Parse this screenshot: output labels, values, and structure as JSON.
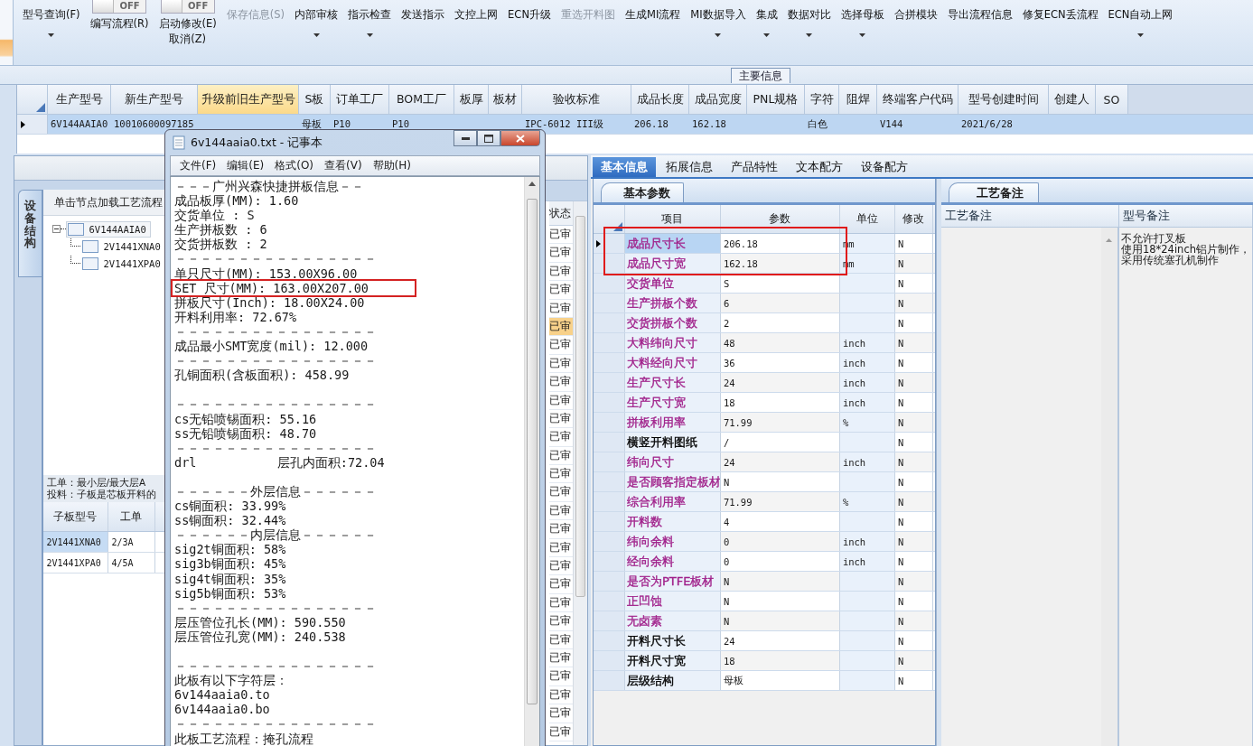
{
  "toolbar": {
    "buttons": [
      {
        "lines": [
          "型号查询(F)"
        ],
        "caret": true,
        "disabled": false
      },
      {
        "lines": [
          "编写流程(R)"
        ],
        "toggle": {
          "label": "OFF",
          "on": false
        },
        "caret": false,
        "disabled": false
      },
      {
        "lines": [
          "启动修改(E)",
          "取消(Z)"
        ],
        "toggle": {
          "label": "OFF",
          "on": false
        },
        "caret": false,
        "disabled": false
      },
      {
        "lines": [
          "保存信息(S)"
        ],
        "caret": false,
        "disabled": true
      },
      {
        "lines": [
          "内部审核"
        ],
        "caret": true,
        "disabled": false
      },
      {
        "lines": [
          "指示检查"
        ],
        "caret": true,
        "disabled": false
      },
      {
        "lines": [
          "发送指示"
        ],
        "caret": false,
        "disabled": false
      },
      {
        "lines": [
          "文控上网"
        ],
        "caret": false,
        "disabled": false
      },
      {
        "lines": [
          "ECN升级"
        ],
        "caret": false,
        "disabled": false
      },
      {
        "lines": [
          "重选开料图"
        ],
        "caret": false,
        "disabled": true
      },
      {
        "lines": [
          "生成MI流程"
        ],
        "caret": false,
        "disabled": false
      },
      {
        "lines": [
          "MI数据导入"
        ],
        "caret": true,
        "disabled": false
      },
      {
        "lines": [
          "集成"
        ],
        "caret": true,
        "disabled": false
      },
      {
        "lines": [
          "数据对比"
        ],
        "caret": true,
        "disabled": false
      },
      {
        "lines": [
          "选择母板"
        ],
        "caret": true,
        "disabled": false
      },
      {
        "lines": [
          "合拼模块"
        ],
        "caret": false,
        "disabled": false
      },
      {
        "lines": [
          "导出流程信息"
        ],
        "caret": false,
        "disabled": false
      },
      {
        "lines": [
          "修复ECN丢流程"
        ],
        "caret": false,
        "disabled": false
      },
      {
        "lines": [
          "ECN自动上网"
        ],
        "caret": true,
        "disabled": false
      }
    ]
  },
  "group_label": "主要信息",
  "main_grid": {
    "columns": [
      {
        "label": "生产型号",
        "highlighted": false
      },
      {
        "label": "新生产型号",
        "highlighted": false
      },
      {
        "label": "升级前旧生产型号",
        "highlighted": true
      },
      {
        "label": "S板",
        "highlighted": false
      },
      {
        "label": "订单工厂",
        "highlighted": false
      },
      {
        "label": "BOM工厂",
        "highlighted": false
      },
      {
        "label": "板厚",
        "highlighted": false
      },
      {
        "label": "板材",
        "highlighted": false
      },
      {
        "label": "验收标准",
        "highlighted": false
      },
      {
        "label": "成品长度",
        "highlighted": false
      },
      {
        "label": "成品宽度",
        "highlighted": false
      },
      {
        "label": "PNL规格",
        "highlighted": false
      },
      {
        "label": "字符",
        "highlighted": false
      },
      {
        "label": "阻焊",
        "highlighted": false
      },
      {
        "label": "终端客户代码",
        "highlighted": false
      },
      {
        "label": "型号创建时间",
        "highlighted": false
      },
      {
        "label": "创建人",
        "highlighted": false
      },
      {
        "label": "SO",
        "highlighted": false
      }
    ],
    "rows": [
      {
        "selected": true,
        "cells": [
          "6V144AAIA0",
          "10010600097185",
          "",
          "母板",
          "P10",
          "P10",
          "",
          "",
          "IPC-6012 III级",
          "206.18",
          "162.18",
          "",
          "白色",
          "",
          "V144",
          "2021/6/28",
          "",
          ""
        ]
      }
    ]
  },
  "left_panel": {
    "vertical_tab": "设备结构",
    "tree_header": "单击节点加载工艺流程",
    "tree": [
      {
        "label": "6V144AAIA0",
        "expanded": true,
        "selected": true,
        "children": [
          {
            "label": "2V1441XNA0",
            "selected": false
          },
          {
            "label": "2V1441XPA0",
            "selected": false
          }
        ]
      }
    ],
    "info_lines": [
      "工单：最小层/最大层A",
      "投料：子板是芯板开料的"
    ],
    "subboards": {
      "columns": [
        "子板型号",
        "工单"
      ],
      "rows": [
        {
          "cells": [
            "2V1441XNA0",
            "2/3A"
          ],
          "selected": true
        },
        {
          "cells": [
            "2V1441XPA0",
            "4/5A"
          ],
          "selected": false
        }
      ]
    },
    "status_column": {
      "header": "状态",
      "cells": [
        {
          "text": "已审",
          "selected": false
        },
        {
          "text": "已审",
          "selected": false
        },
        {
          "text": "已审",
          "selected": false
        },
        {
          "text": "已审",
          "selected": false
        },
        {
          "text": "已审",
          "selected": false
        },
        {
          "text": "已审",
          "selected": true
        },
        {
          "text": "已审",
          "selected": false
        },
        {
          "text": "已审",
          "selected": false
        },
        {
          "text": "已审",
          "selected": false
        },
        {
          "text": "已审",
          "selected": false
        },
        {
          "text": "已审",
          "selected": false
        },
        {
          "text": "已审",
          "selected": false
        },
        {
          "text": "已审",
          "selected": false
        },
        {
          "text": "已审",
          "selected": false
        },
        {
          "text": "已审",
          "selected": false
        },
        {
          "text": "已审",
          "selected": false
        },
        {
          "text": "已审",
          "selected": false
        },
        {
          "text": "已审",
          "selected": false
        },
        {
          "text": "已审",
          "selected": false
        },
        {
          "text": "已审",
          "selected": false
        },
        {
          "text": "已审",
          "selected": false
        },
        {
          "text": "已审",
          "selected": false
        },
        {
          "text": "已审",
          "selected": false
        },
        {
          "text": "已审",
          "selected": false
        },
        {
          "text": "已审",
          "selected": false
        },
        {
          "text": "已审",
          "selected": false
        },
        {
          "text": "已审",
          "selected": false
        },
        {
          "text": "已审",
          "selected": false
        }
      ]
    }
  },
  "right_panel": {
    "tabs": [
      {
        "label": "基本信息",
        "selected": true
      },
      {
        "label": "拓展信息",
        "selected": false
      },
      {
        "label": "产品特性",
        "selected": false
      },
      {
        "label": "文本配方",
        "selected": false
      },
      {
        "label": "设备配方",
        "selected": false
      }
    ],
    "params_tab": "基本参数",
    "params_columns": [
      "项目",
      "参数",
      "单位",
      "修改"
    ],
    "params": [
      {
        "name": "成品尺寸长",
        "value": "206.18",
        "unit": "mm",
        "modified": "N",
        "color": "#a0208a",
        "selected": true,
        "highlighted": true
      },
      {
        "name": "成品尺寸宽",
        "value": "162.18",
        "unit": "mm",
        "modified": "N",
        "color": "#a0208a",
        "selected": false,
        "highlighted": true
      },
      {
        "name": "交货单位",
        "value": "S",
        "modified": "N",
        "color": "#a0208a",
        "selected": false,
        "highlighted": false
      },
      {
        "name": "生产拼板个数",
        "value": "6",
        "modified": "N",
        "color": "#a0208a",
        "selected": false,
        "highlighted": false
      },
      {
        "name": "交货拼板个数",
        "value": "2",
        "modified": "N",
        "color": "#a0208a",
        "selected": false,
        "highlighted": false
      },
      {
        "name": "大料纬向尺寸",
        "value": "48",
        "unit": "inch",
        "modified": "N",
        "color": "#a0208a",
        "selected": false,
        "highlighted": false
      },
      {
        "name": "大料经向尺寸",
        "value": "36",
        "unit": "inch",
        "modified": "N",
        "color": "#a0208a",
        "selected": false,
        "highlighted": false
      },
      {
        "name": "生产尺寸长",
        "value": "24",
        "unit": "inch",
        "modified": "N",
        "color": "#a0208a",
        "selected": false,
        "highlighted": false
      },
      {
        "name": "生产尺寸宽",
        "value": "18",
        "unit": "inch",
        "modified": "N",
        "color": "#a0208a",
        "selected": false,
        "highlighted": false
      },
      {
        "name": "拼板利用率",
        "value": "71.99",
        "unit": "%",
        "modified": "N",
        "color": "#a0208a",
        "selected": false,
        "highlighted": false
      },
      {
        "name": "横竖开料图纸",
        "value": "/",
        "modified": "N",
        "color": "#000000",
        "selected": false,
        "highlighted": false
      },
      {
        "name": "纬向尺寸",
        "value": "24",
        "unit": "inch",
        "modified": "N",
        "color": "#a0208a",
        "selected": false,
        "highlighted": false
      },
      {
        "name": "是否顾客指定板材",
        "value": "N",
        "modified": "N",
        "color": "#a0208a",
        "selected": false,
        "highlighted": false
      },
      {
        "name": "综合利用率",
        "value": "71.99",
        "unit": "%",
        "modified": "N",
        "color": "#a0208a",
        "selected": false,
        "highlighted": false
      },
      {
        "name": "开料数",
        "value": "4",
        "modified": "N",
        "color": "#a0208a",
        "selected": false,
        "highlighted": false
      },
      {
        "name": "纬向余料",
        "value": "0",
        "unit": "inch",
        "modified": "N",
        "color": "#a0208a",
        "selected": false,
        "highlighted": false
      },
      {
        "name": "经向余料",
        "value": "0",
        "unit": "inch",
        "modified": "N",
        "color": "#a0208a",
        "selected": false,
        "highlighted": false
      },
      {
        "name": "是否为PTFE板材",
        "value": "N",
        "modified": "N",
        "color": "#a0208a",
        "selected": false,
        "highlighted": false
      },
      {
        "name": "正凹蚀",
        "value": "N",
        "modified": "N",
        "color": "#a0208a",
        "selected": false,
        "highlighted": false
      },
      {
        "name": "无卤素",
        "value": "N",
        "modified": "N",
        "color": "#a0208a",
        "selected": false,
        "highlighted": false
      },
      {
        "name": "开料尺寸长",
        "value": "24",
        "modified": "N",
        "color": "#000000",
        "selected": false,
        "highlighted": false
      },
      {
        "name": "开料尺寸宽",
        "value": "18",
        "modified": "N",
        "color": "#000000",
        "selected": false,
        "highlighted": false
      },
      {
        "name": "层级结构",
        "value": "母板",
        "modified": "N",
        "color": "#000000",
        "selected": false,
        "highlighted": false
      }
    ],
    "notes_tab": "工艺备注",
    "notes_columns": [
      "工艺备注",
      "型号备注"
    ],
    "model_note": [
      "不允许打叉板",
      "使用18*24inch铝片制作，",
      "采用传统塞孔机制作"
    ]
  },
  "notepad": {
    "title": "6v144aaia0.txt - 记事本",
    "menu": [
      "文件(F)",
      "编辑(E)",
      "格式(O)",
      "查看(V)",
      "帮助(H)"
    ],
    "lines": [
      {
        "text": "－－－广州兴森快捷拼板信息－－",
        "gap_before": false,
        "highlighted": false
      },
      {
        "text": "成品板厚(MM): 1.60",
        "gap_before": false,
        "highlighted": false
      },
      {
        "text": "交货单位 : S",
        "gap_before": false,
        "highlighted": false
      },
      {
        "text": "生产拼板数 : 6",
        "gap_before": false,
        "highlighted": false
      },
      {
        "text": "交货拼板数 : 2",
        "gap_before": false,
        "highlighted": false
      },
      {
        "text": "－－－－－－－－－－－－－－－－",
        "gap_before": false,
        "highlighted": false
      },
      {
        "text": "单只尺寸(MM): 153.00X96.00",
        "gap_before": false,
        "highlighted": false
      },
      {
        "text": "SET 尺寸(MM): 163.00X207.00",
        "gap_before": false,
        "highlighted": true
      },
      {
        "text": "拼板尺寸(Inch): 18.00X24.00",
        "gap_before": false,
        "highlighted": false
      },
      {
        "text": "开料利用率: 72.67%",
        "gap_before": false,
        "highlighted": false
      },
      {
        "text": "－－－－－－－－－－－－－－－－",
        "gap_before": false,
        "highlighted": false
      },
      {
        "text": "成品最小SMT宽度(mil): 12.000",
        "gap_before": false,
        "highlighted": false
      },
      {
        "text": "－－－－－－－－－－－－－－－－",
        "gap_before": false,
        "highlighted": false
      },
      {
        "text": "孔铜面积(含板面积): 458.99",
        "gap_before": false,
        "highlighted": false
      },
      {
        "text": "－－－－－－－－－－－－－－－－",
        "gap_before": true,
        "highlighted": false
      },
      {
        "text": "cs无铅喷锡面积: 55.16",
        "gap_before": false,
        "highlighted": false
      },
      {
        "text": "ss无铅喷锡面积: 48.70",
        "gap_before": false,
        "highlighted": false
      },
      {
        "text": "－－－－－－－－－－－－－－－－",
        "gap_before": false,
        "highlighted": false
      },
      {
        "text": "drl           层孔内面积:72.04",
        "gap_before": false,
        "highlighted": false
      },
      {
        "text": "－－－－－－外层信息－－－－－－",
        "gap_before": true,
        "highlighted": false
      },
      {
        "text": "cs铜面积: 33.99%",
        "gap_before": false,
        "highlighted": false
      },
      {
        "text": "ss铜面积: 32.44%",
        "gap_before": false,
        "highlighted": false
      },
      {
        "text": "－－－－－－内层信息－－－－－－",
        "gap_before": false,
        "highlighted": false
      },
      {
        "text": "sig2t铜面积: 58%",
        "gap_before": false,
        "highlighted": false
      },
      {
        "text": "sig3b铜面积: 45%",
        "gap_before": false,
        "highlighted": false
      },
      {
        "text": "sig4t铜面积: 35%",
        "gap_before": false,
        "highlighted": false
      },
      {
        "text": "sig5b铜面积: 53%",
        "gap_before": false,
        "highlighted": false
      },
      {
        "text": "－－－－－－－－－－－－－－－－",
        "gap_before": false,
        "highlighted": false
      },
      {
        "text": "层压管位孔长(MM): 590.550",
        "gap_before": false,
        "highlighted": false
      },
      {
        "text": "层压管位孔宽(MM): 240.538",
        "gap_before": false,
        "highlighted": false
      },
      {
        "text": "－－－－－－－－－－－－－－－－",
        "gap_before": true,
        "highlighted": false
      },
      {
        "text": "此板有以下字符层：",
        "gap_before": false,
        "highlighted": false
      },
      {
        "text": "6v144aaia0.to",
        "gap_before": false,
        "highlighted": false
      },
      {
        "text": "6v144aaia0.bo",
        "gap_before": false,
        "highlighted": false
      },
      {
        "text": "－－－－－－－－－－－－－－－－",
        "gap_before": false,
        "highlighted": false
      },
      {
        "text": "此板工艺流程：掩孔流程",
        "gap_before": false,
        "highlighted": false
      }
    ]
  }
}
